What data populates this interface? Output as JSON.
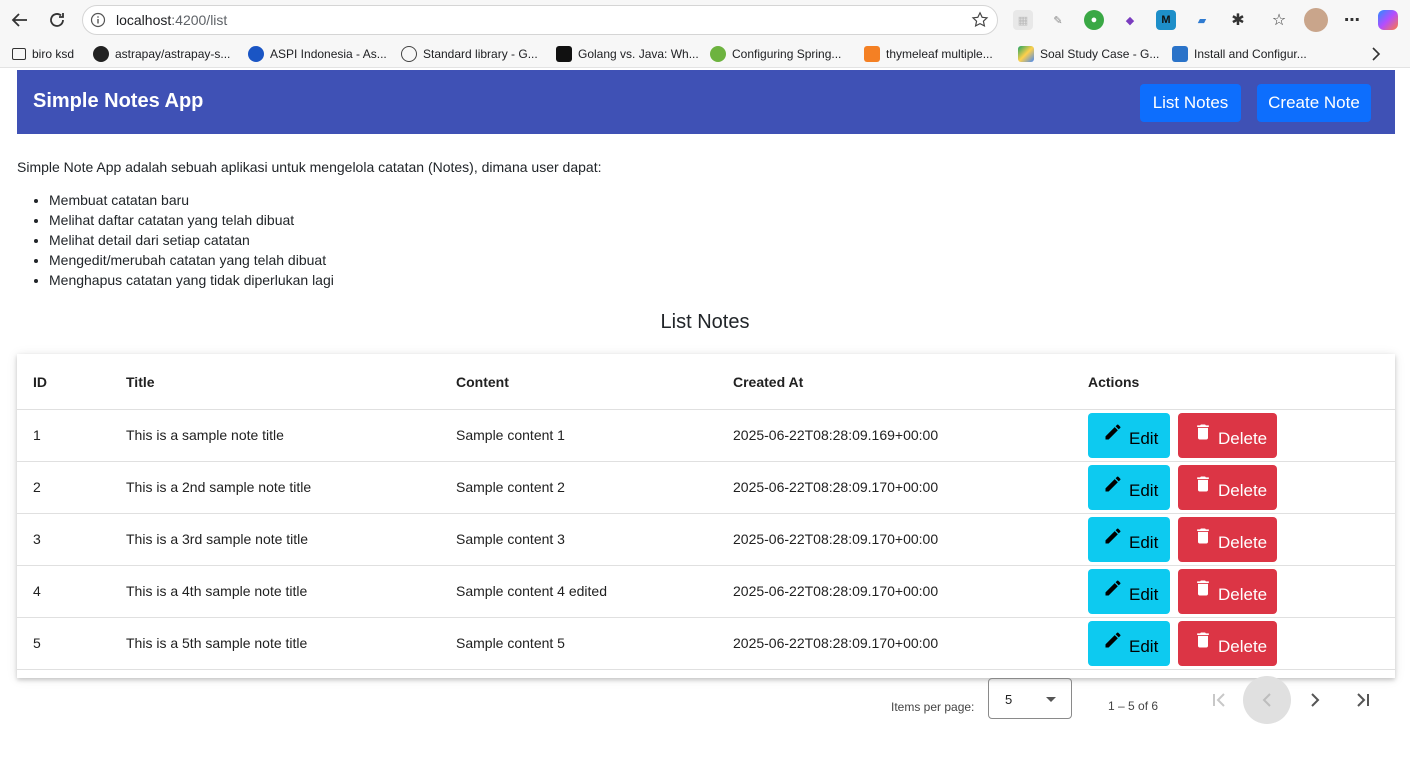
{
  "browser": {
    "url_host": "localhost",
    "url_rest": ":4200/list",
    "bookmarks": [
      {
        "label": "biro ksd"
      },
      {
        "label": "astrapay/astrapay-s..."
      },
      {
        "label": "ASPI Indonesia - As..."
      },
      {
        "label": "Standard library - G..."
      },
      {
        "label": "Golang vs. Java: Wh..."
      },
      {
        "label": "Configuring Spring..."
      },
      {
        "label": "thymeleaf multiple..."
      },
      {
        "label": "Soal Study Case - G..."
      },
      {
        "label": "Install and Configur..."
      }
    ]
  },
  "app": {
    "brand": "Simple Notes App",
    "nav": {
      "list": "List Notes",
      "create": "Create Note"
    },
    "intro": "Simple Note App adalah sebuah aplikasi untuk mengelola catatan (Notes), dimana user dapat:",
    "features": [
      "Membuat catatan baru",
      "Melihat daftar catatan yang telah dibuat",
      "Melihat detail dari setiap catatan",
      "Mengedit/merubah catatan yang telah dibuat",
      "Menghapus catatan yang tidak diperlukan lagi"
    ],
    "section_title": "List Notes"
  },
  "table": {
    "headers": {
      "id": "ID",
      "title": "Title",
      "content": "Content",
      "created": "Created At",
      "actions": "Actions"
    },
    "edit_label": "Edit",
    "delete_label": "Delete",
    "rows": [
      {
        "id": "1",
        "title": "This is a sample note title",
        "content": "Sample content 1",
        "created": "2025-06-22T08:28:09.169+00:00"
      },
      {
        "id": "2",
        "title": "This is a 2nd sample note title",
        "content": "Sample content 2",
        "created": "2025-06-22T08:28:09.170+00:00"
      },
      {
        "id": "3",
        "title": "This is a 3rd sample note title",
        "content": "Sample content 3",
        "created": "2025-06-22T08:28:09.170+00:00"
      },
      {
        "id": "4",
        "title": "This is a 4th sample note title",
        "content": "Sample content 4 edited",
        "created": "2025-06-22T08:28:09.170+00:00"
      },
      {
        "id": "5",
        "title": "This is a 5th sample note title",
        "content": "Sample content 5",
        "created": "2025-06-22T08:28:09.170+00:00"
      }
    ]
  },
  "paginator": {
    "label": "Items per page:",
    "page_size": "5",
    "range": "1 – 5 of 6"
  },
  "colors": {
    "navbar": "#3f51b5",
    "primary": "#0d6efd",
    "info": "#0dcaf0",
    "danger": "#dc3545"
  }
}
